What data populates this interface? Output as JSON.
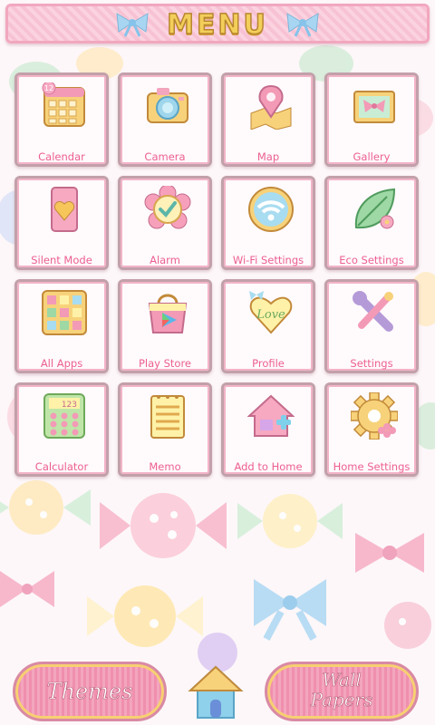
{
  "header": {
    "title": "MENU"
  },
  "menu": [
    {
      "label": "Calendar",
      "icon": "calendar-icon",
      "badge": "12"
    },
    {
      "label": "Camera",
      "icon": "camera-icon"
    },
    {
      "label": "Map",
      "icon": "map-pin-icon"
    },
    {
      "label": "Gallery",
      "icon": "gallery-ribbon-icon"
    },
    {
      "label": "Silent Mode",
      "icon": "phone-heart-icon"
    },
    {
      "label": "Alarm",
      "icon": "flower-check-icon"
    },
    {
      "label": "Wi-Fi Settings",
      "icon": "wifi-icon"
    },
    {
      "label": "Eco Settings",
      "icon": "leaf-icon"
    },
    {
      "label": "All Apps",
      "icon": "grid-apps-icon"
    },
    {
      "label": "Play Store",
      "icon": "shopping-bag-play-icon"
    },
    {
      "label": "Profile",
      "icon": "heart-love-icon",
      "badge": "Love"
    },
    {
      "label": "Settings",
      "icon": "wrench-screwdriver-icon"
    },
    {
      "label": "Calculator",
      "icon": "calculator-icon",
      "badge": "123"
    },
    {
      "label": "Memo",
      "icon": "memo-pad-icon"
    },
    {
      "label": "Add to Home",
      "icon": "house-plus-icon"
    },
    {
      "label": "Home Settings",
      "icon": "gear-flower-icon"
    }
  ],
  "bottom": {
    "themes": "Themes",
    "wallpapers_line1": "Wall",
    "wallpapers_line2": "Papers"
  },
  "colors": {
    "label": "#ec5f92",
    "frame": "#c2a0aa",
    "pink": "#f3b4c8",
    "gold": "#f3cf5a"
  }
}
